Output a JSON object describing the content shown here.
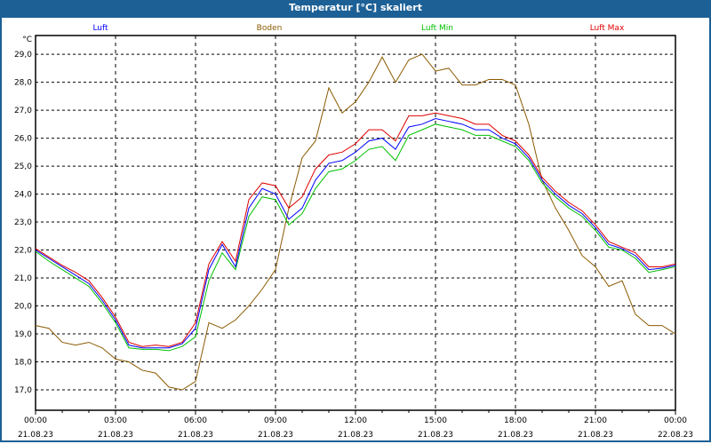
{
  "title": "Temperatur [°C] skaliert",
  "chart_data": {
    "type": "line",
    "title": "Temperatur [°C] skaliert",
    "ylabel": "°C",
    "ylim": [
      16.27,
      29.67
    ],
    "yticks": [
      "17,0",
      "18,0",
      "19,0",
      "20,0",
      "21,0",
      "22,0",
      "23,0",
      "24,0",
      "25,0",
      "26,0",
      "27,0",
      "28,0",
      "29,0"
    ],
    "xlim_hours": [
      0,
      24
    ],
    "xticks": [
      [
        "00:00",
        "21.08.23"
      ],
      [
        "03:00",
        "21.08.23"
      ],
      [
        "06:00",
        "21.08.23"
      ],
      [
        "09:00",
        "21.08.23"
      ],
      [
        "12:00",
        "21.08.23"
      ],
      [
        "15:00",
        "21.08.23"
      ],
      [
        "18:00",
        "21.08.23"
      ],
      [
        "21:00",
        "21.08.23"
      ],
      [
        "00:00",
        "22.08.23"
      ]
    ],
    "x_step_hours": 0.5,
    "grid": true,
    "legend_position": "top",
    "series": [
      {
        "name": "Luft",
        "color": "#0000ff",
        "values": [
          22.0,
          21.7,
          21.4,
          21.1,
          20.8,
          20.2,
          19.5,
          18.6,
          18.5,
          18.5,
          18.5,
          18.65,
          19.2,
          21.3,
          22.2,
          21.4,
          23.5,
          24.2,
          24.0,
          23.1,
          23.5,
          24.5,
          25.1,
          25.2,
          25.5,
          25.9,
          26.0,
          25.6,
          26.4,
          26.5,
          26.7,
          26.6,
          26.5,
          26.3,
          26.3,
          26.0,
          25.8,
          25.3,
          24.5,
          24.0,
          23.6,
          23.3,
          22.8,
          22.2,
          22.05,
          21.8,
          21.3,
          21.35,
          21.45
        ]
      },
      {
        "name": "Boden",
        "color": "#8b5a00",
        "values": [
          19.3,
          19.2,
          18.7,
          18.6,
          18.7,
          18.5,
          18.1,
          18.0,
          17.7,
          17.6,
          17.1,
          17.0,
          17.3,
          19.4,
          19.2,
          19.5,
          20.0,
          20.6,
          21.3,
          23.5,
          25.3,
          25.9,
          27.8,
          26.9,
          27.3,
          28.0,
          28.9,
          28.0,
          28.8,
          29.0,
          28.4,
          28.5,
          27.9,
          27.9,
          28.1,
          28.1,
          27.9,
          26.5,
          24.5,
          23.5,
          22.7,
          21.8,
          21.4,
          20.7,
          20.9,
          19.7,
          19.3,
          19.3,
          19.0
        ]
      },
      {
        "name": "Luft Min",
        "color": "#00c000",
        "values": [
          21.95,
          21.6,
          21.3,
          21.0,
          20.7,
          20.1,
          19.4,
          18.5,
          18.45,
          18.45,
          18.4,
          18.55,
          18.9,
          20.9,
          21.9,
          21.3,
          23.2,
          23.9,
          23.8,
          22.9,
          23.3,
          24.2,
          24.8,
          24.9,
          25.2,
          25.6,
          25.7,
          25.2,
          26.1,
          26.3,
          26.5,
          26.4,
          26.3,
          26.1,
          26.1,
          25.9,
          25.7,
          25.2,
          24.4,
          23.9,
          23.5,
          23.2,
          22.7,
          22.1,
          22.0,
          21.7,
          21.2,
          21.3,
          21.4
        ]
      },
      {
        "name": "Luft Max",
        "color": "#e00000",
        "values": [
          22.05,
          21.75,
          21.45,
          21.2,
          20.9,
          20.3,
          19.6,
          18.7,
          18.55,
          18.6,
          18.55,
          18.7,
          19.4,
          21.5,
          22.3,
          21.6,
          23.8,
          24.4,
          24.3,
          23.5,
          23.9,
          24.9,
          25.4,
          25.5,
          25.8,
          26.3,
          26.3,
          25.9,
          26.8,
          26.8,
          26.9,
          26.8,
          26.7,
          26.5,
          26.5,
          26.1,
          25.9,
          25.4,
          24.6,
          24.1,
          23.7,
          23.4,
          22.9,
          22.3,
          22.1,
          21.9,
          21.4,
          21.4,
          21.5
        ]
      }
    ]
  }
}
